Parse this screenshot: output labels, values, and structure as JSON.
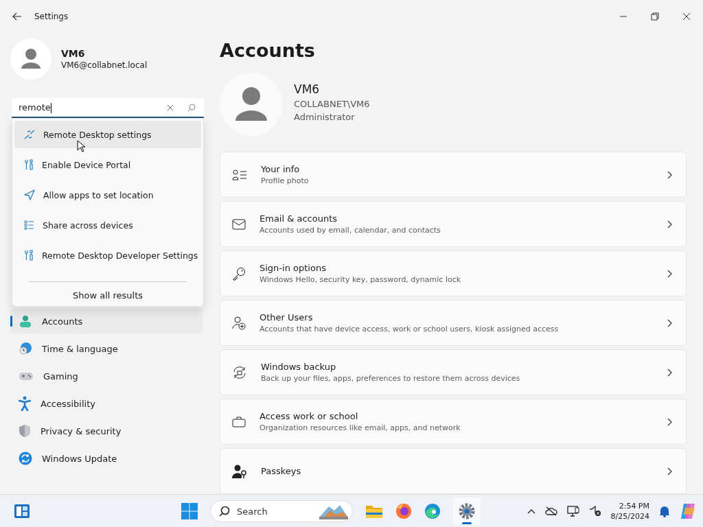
{
  "window": {
    "title": "Settings"
  },
  "user": {
    "name": "VM6",
    "email": "VM6@collabnet.local"
  },
  "search": {
    "value": "remote",
    "results": [
      {
        "label": "Remote Desktop settings",
        "kind": "remote",
        "selected": true
      },
      {
        "label": "Enable Device Portal",
        "kind": "tools",
        "selected": false
      },
      {
        "label": "Allow apps to set location",
        "kind": "location",
        "selected": false
      },
      {
        "label": "Share across devices",
        "kind": "list",
        "selected": false
      },
      {
        "label": "Remote Desktop Developer Settings",
        "kind": "tools",
        "selected": false
      }
    ],
    "show_all": "Show all results"
  },
  "nav": [
    {
      "label": "Accounts",
      "kind": "accounts",
      "selected": true
    },
    {
      "label": "Time & language",
      "kind": "time",
      "selected": false
    },
    {
      "label": "Gaming",
      "kind": "gaming",
      "selected": false
    },
    {
      "label": "Accessibility",
      "kind": "accessibility",
      "selected": false
    },
    {
      "label": "Privacy & security",
      "kind": "privacy",
      "selected": false
    },
    {
      "label": "Windows Update",
      "kind": "update",
      "selected": false
    }
  ],
  "page": {
    "title": "Accounts",
    "profile": {
      "name": "VM6",
      "domain": "COLLABNET\\VM6",
      "role": "Administrator"
    },
    "items": [
      {
        "title": "Your info",
        "subtitle": "Profile photo",
        "kind": "info"
      },
      {
        "title": "Email & accounts",
        "subtitle": "Accounts used by email, calendar, and contacts",
        "kind": "mail"
      },
      {
        "title": "Sign-in options",
        "subtitle": "Windows Hello, security key, password, dynamic lock",
        "kind": "key"
      },
      {
        "title": "Other Users",
        "subtitle": "Accounts that have device access, work or school users, kiosk assigned access",
        "kind": "users"
      },
      {
        "title": "Windows backup",
        "subtitle": "Back up your files, apps, preferences to restore them across devices",
        "kind": "backup"
      },
      {
        "title": "Access work or school",
        "subtitle": "Organization resources like email, apps, and network",
        "kind": "briefcase"
      },
      {
        "title": "Passkeys",
        "kind": "passkey"
      }
    ]
  },
  "taskbar": {
    "search_placeholder": "Search",
    "time": "2:54 PM",
    "date": "8/25/2024"
  }
}
